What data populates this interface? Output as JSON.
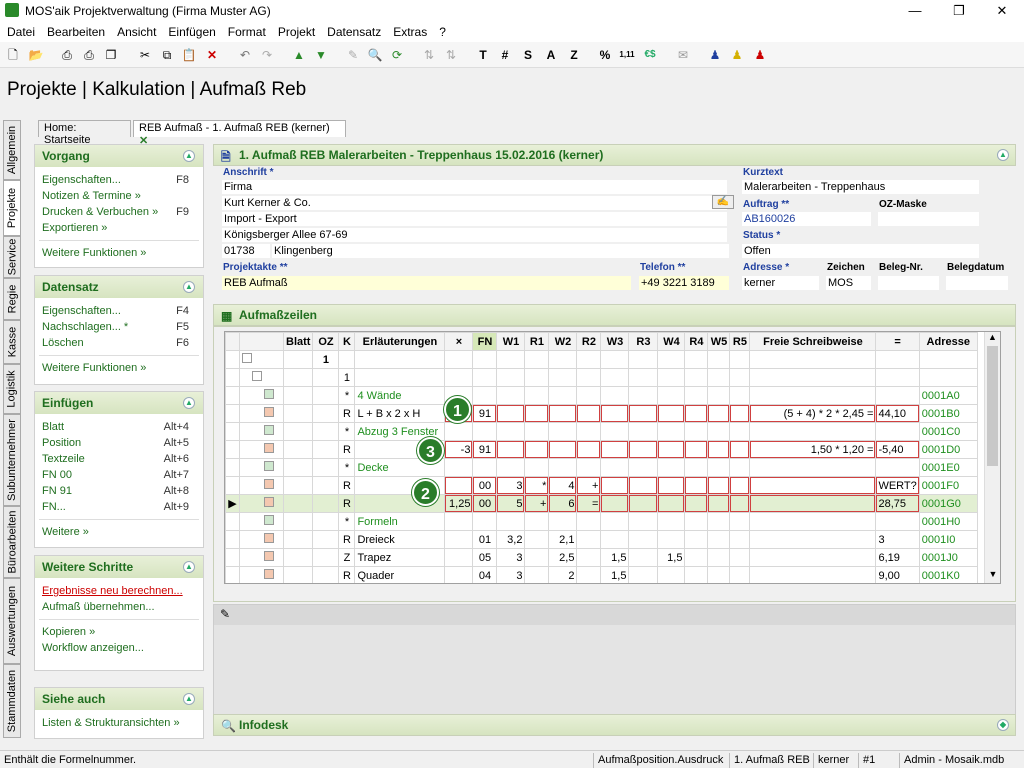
{
  "window": {
    "title": "MOS'aik Projektverwaltung (Firma Muster AG)",
    "min": "—",
    "max": "❐",
    "close": "✕"
  },
  "menu": [
    "Datei",
    "Bearbeiten",
    "Ansicht",
    "Einfügen",
    "Format",
    "Projekt",
    "Datensatz",
    "Extras",
    "?"
  ],
  "toolbar": {
    "t": "T",
    "hash": "#",
    "s": "S",
    "a": "A",
    "z": "Z",
    "pct": "%",
    "num": "1,11",
    "eur": "€$"
  },
  "breadcrumb": "Projekte | Kalkulation | Aufmaß Reb",
  "tabs": {
    "home": "Home: Startseite",
    "active": "REB Aufmaß - 1. Aufmaß REB (kerner)"
  },
  "vtabs": [
    "Allgemein",
    "Projekte",
    "Service",
    "Regie",
    "Kasse",
    "Logistik",
    "Subunternehmer",
    "Büroarbeiten",
    "Auswertungen",
    "Stammdaten"
  ],
  "sidebar": {
    "vorgang": {
      "title": "Vorgang",
      "items": [
        {
          "l": "Eigenschaften...",
          "k": "F8"
        },
        {
          "l": "Notizen & Termine »",
          "k": ""
        },
        {
          "l": "Drucken & Verbuchen »",
          "k": "F9"
        },
        {
          "l": "Exportieren »",
          "k": ""
        }
      ],
      "more": "Weitere Funktionen »"
    },
    "datensatz": {
      "title": "Datensatz",
      "items": [
        {
          "l": "Eigenschaften...",
          "k": "F4"
        },
        {
          "l": "Nachschlagen... *",
          "k": "F5"
        },
        {
          "l": "Löschen",
          "k": "F6"
        }
      ],
      "more": "Weitere Funktionen »"
    },
    "einfuegen": {
      "title": "Einfügen",
      "items": [
        {
          "l": "Blatt",
          "k": "Alt+4"
        },
        {
          "l": "Position",
          "k": "Alt+5"
        },
        {
          "l": "Textzeile",
          "k": "Alt+6"
        },
        {
          "l": "FN 00",
          "k": "Alt+7"
        },
        {
          "l": "FN 91",
          "k": "Alt+8"
        },
        {
          "l": "FN...",
          "k": "Alt+9"
        }
      ],
      "more": "Weitere »"
    },
    "schritte": {
      "title": "Weitere Schritte",
      "a": "Ergebnisse neu berechnen...",
      "b": "Aufmaß übernehmen...",
      "c": "Kopieren »",
      "d": "Workflow anzeigen..."
    },
    "siehe": {
      "title": "Siehe auch",
      "a": "Listen & Strukturansichten »"
    }
  },
  "header": {
    "title": "1. Aufmaß REB Malerarbeiten - Treppenhaus 15.02.2016 (kerner)",
    "anschrift_l": "Anschrift *",
    "a1": "Firma",
    "a2": "Kurt Kerner & Co.",
    "a3": "Import - Export",
    "a4": "Königsberger Allee 67-69",
    "plz": "01738",
    "ort": "Klingenberg",
    "kurztext_l": "Kurztext",
    "kurztext": "Malerarbeiten - Treppenhaus",
    "auftrag_l": "Auftrag **",
    "auftrag": "AB160026",
    "ozmaske_l": "OZ-Maske",
    "status_l": "Status *",
    "status": "Offen",
    "projektakte_l": "Projektakte **",
    "projektakte": "REB Aufmaß",
    "telefon_l": "Telefon **",
    "telefon": "+49 3221 3189",
    "adresse_l": "Adresse *",
    "adresse": "kerner",
    "zeichen_l": "Zeichen",
    "zeichen": "MOS",
    "belegnr_l": "Beleg-Nr.",
    "belegdatum_l": "Belegdatum"
  },
  "aufmass": {
    "title": "Aufmaßzeilen",
    "columns": [
      "Blatt",
      "OZ",
      "K",
      "Erläuterungen",
      "×",
      "FN",
      "W1",
      "R1",
      "W2",
      "R2",
      "W3",
      "R3",
      "W4",
      "R4",
      "W5",
      "R5",
      "Freie Schreibweise",
      "=",
      "Adresse"
    ],
    "rows": [
      [
        "",
        "1",
        "",
        "",
        "",
        "",
        "",
        "",
        "",
        "",
        "",
        "",
        "",
        "",
        "",
        "",
        "",
        "",
        ""
      ],
      [
        "",
        "",
        "1",
        "",
        "",
        "",
        "",
        "",
        "",
        "",
        "",
        "",
        "",
        "",
        "",
        "",
        "",
        "",
        ""
      ],
      [
        "",
        "",
        "*",
        "4 Wände",
        "",
        "",
        "",
        "",
        "",
        "",
        "",
        "",
        "",
        "",
        "",
        "",
        "",
        "",
        "0001A0"
      ],
      [
        "",
        "",
        "R",
        "L + B x 2 x H",
        "",
        "91",
        "",
        "",
        "",
        "",
        "",
        "",
        "",
        "",
        "",
        "",
        "(5 + 4) * 2 * 2,45 =",
        "44,10",
        "0001B0"
      ],
      [
        "",
        "",
        "*",
        "Abzug 3 Fenster",
        "",
        "",
        "",
        "",
        "",
        "",
        "",
        "",
        "",
        "",
        "",
        "",
        "",
        "",
        "0001C0"
      ],
      [
        "",
        "",
        "R",
        "",
        "-3",
        "91",
        "",
        "",
        "",
        "",
        "",
        "",
        "",
        "",
        "",
        "",
        "1,50 * 1,20 =",
        "-5,40",
        "0001D0"
      ],
      [
        "",
        "",
        "*",
        "Decke",
        "",
        "",
        "",
        "",
        "",
        "",
        "",
        "",
        "",
        "",
        "",
        "",
        "",
        "",
        "0001E0"
      ],
      [
        "",
        "",
        "R",
        "",
        "",
        "00",
        "3",
        "*",
        "4",
        "+",
        "",
        "",
        "",
        "",
        "",
        "",
        "",
        "WERT?",
        "0001F0"
      ],
      [
        "",
        "",
        "R",
        "",
        "1,25",
        "00",
        "5",
        "+",
        "6",
        "=",
        "",
        "",
        "",
        "",
        "",
        "",
        "",
        "28,75",
        "0001G0"
      ],
      [
        "",
        "",
        "*",
        "Formeln",
        "",
        "",
        "",
        "",
        "",
        "",
        "",
        "",
        "",
        "",
        "",
        "",
        "",
        "",
        "0001H0"
      ],
      [
        "",
        "",
        "R",
        "Dreieck",
        "",
        "01",
        "3,2",
        "",
        "2,1",
        "",
        "",
        "",
        "",
        "",
        "",
        "",
        "",
        "3",
        "0001I0"
      ],
      [
        "",
        "",
        "Z",
        "Trapez",
        "",
        "05",
        "3",
        "",
        "2,5",
        "",
        "1,5",
        "",
        "1,5",
        "",
        "",
        "",
        "",
        "6,19",
        "0001J0"
      ],
      [
        "",
        "",
        "R",
        "Quader",
        "",
        "04",
        "3",
        "",
        "2",
        "",
        "1,5",
        "",
        "",
        "",
        "",
        "",
        "",
        "9,00",
        "0001K0"
      ]
    ]
  },
  "markers": [
    "1",
    "2",
    "3"
  ],
  "infodesk": "Infodesk",
  "status": {
    "left": "Enthält die Formelnummer.",
    "c1": "Aufmaßposition.Ausdruck",
    "c2": "1. Aufmaß REB",
    "c3": "kerner",
    "c4": "#1",
    "c5": "Admin - Mosaik.mdb"
  }
}
